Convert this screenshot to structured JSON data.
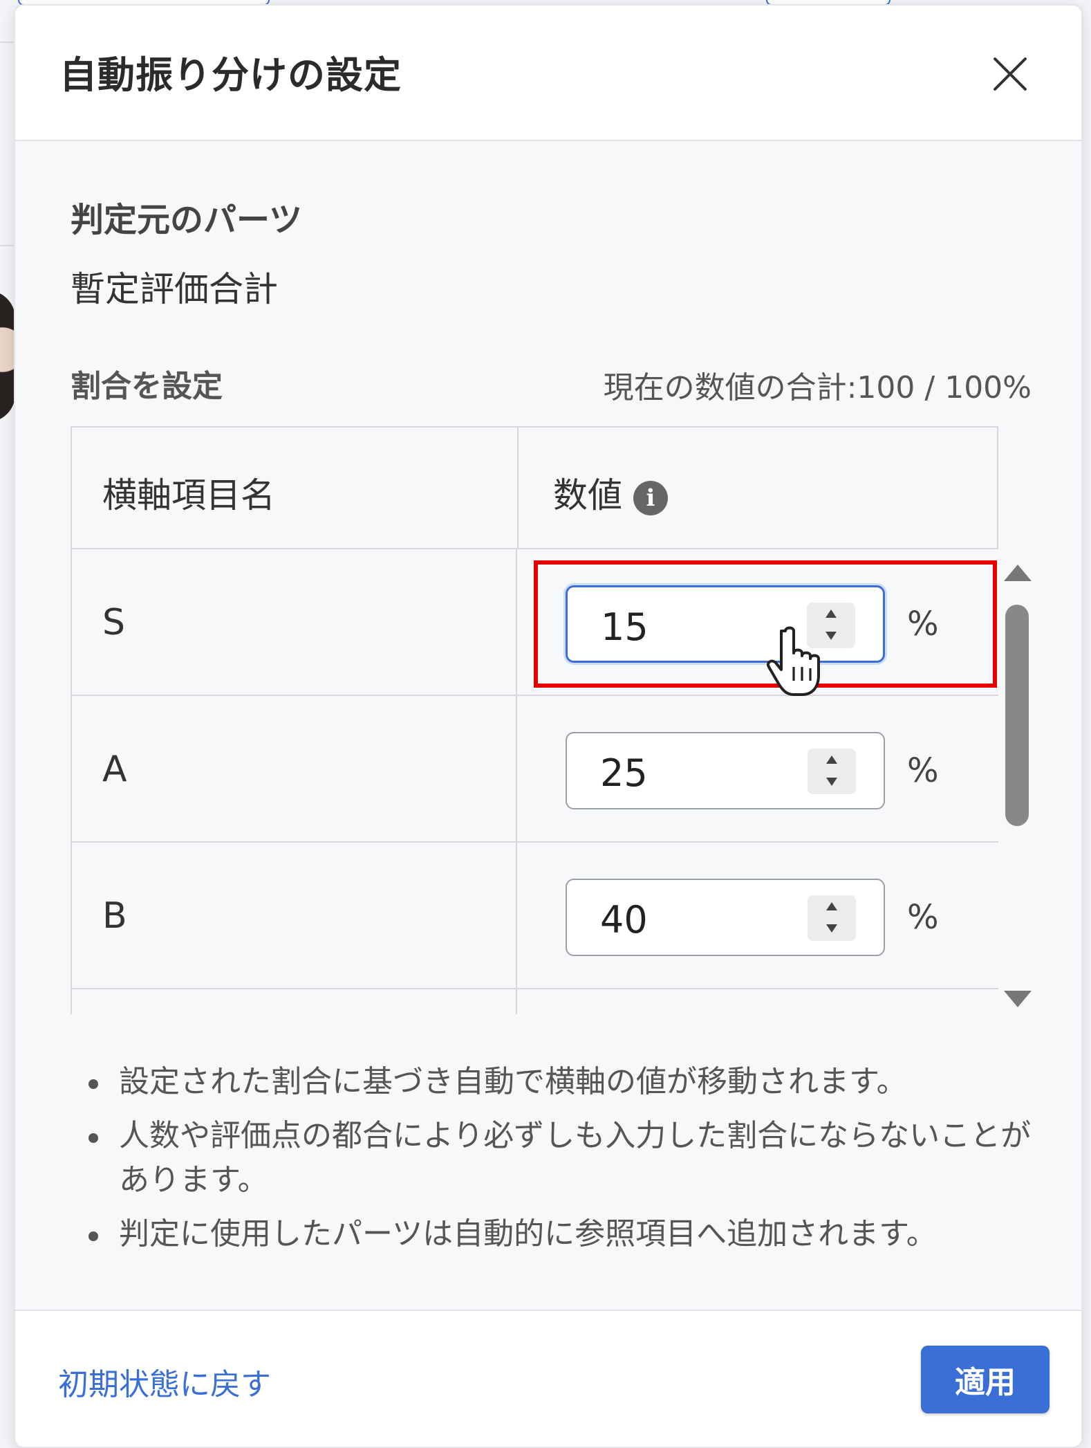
{
  "modal": {
    "title": "自動振り分けの設定",
    "close_label": "×"
  },
  "source_part": {
    "heading": "判定元のパーツ",
    "value": "暫定評価合計"
  },
  "ratio": {
    "heading": "割合を設定",
    "total_text": "現在の数値の合計:100 / 100%"
  },
  "table": {
    "headers": {
      "name": "横軸項目名",
      "value": "数値"
    },
    "info_icon": "i",
    "unit": "%",
    "rows": [
      {
        "label": "S",
        "value": "15",
        "focused": true
      },
      {
        "label": "A",
        "value": "25",
        "focused": false
      },
      {
        "label": "B",
        "value": "40",
        "focused": false
      }
    ]
  },
  "notes": [
    "設定された割合に基づき自動で横軸の値が移動されます。",
    "人数や評価点の都合により必ずしも入力した割合にならないことがあります。",
    "判定に使用したパーツは自動的に参照項目へ追加されます。"
  ],
  "footer": {
    "reset_label": "初期状態に戻す",
    "apply_label": "適用"
  },
  "colors": {
    "accent": "#3a6fd8",
    "highlight": "#e60000"
  }
}
